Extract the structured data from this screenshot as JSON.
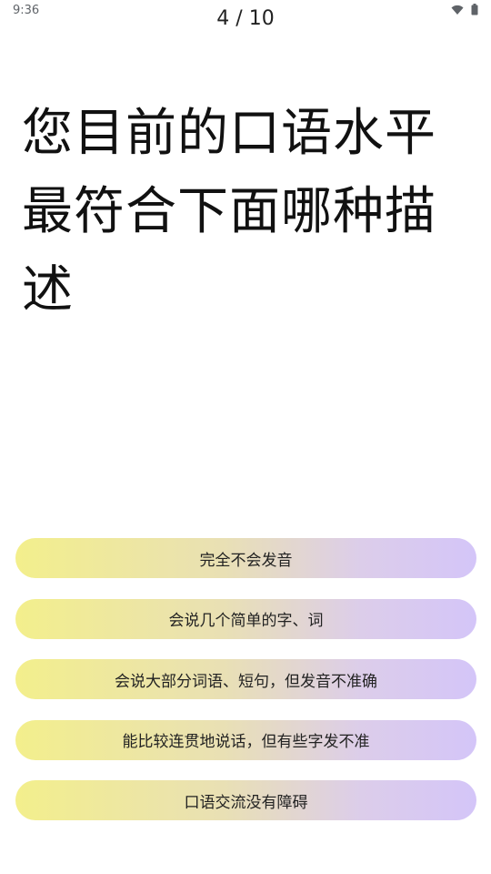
{
  "status_bar": {
    "time": "9:36",
    "icons": [
      "wifi-icon",
      "battery-icon"
    ]
  },
  "header": {
    "progress": "4 / 10"
  },
  "question": {
    "text": "您目前的口语水平最符合下面哪种描述"
  },
  "options": [
    {
      "label": "完全不会发音"
    },
    {
      "label": "会说几个简单的字、词"
    },
    {
      "label": "会说大部分词语、短句，但发音不准确"
    },
    {
      "label": "能比较连贯地说话，但有些字发不准"
    },
    {
      "label": "口语交流没有障碍"
    }
  ],
  "colors": {
    "option_gradient_start": "#f3ef8c",
    "option_gradient_end": "#d4c5f8",
    "text": "#111111"
  }
}
